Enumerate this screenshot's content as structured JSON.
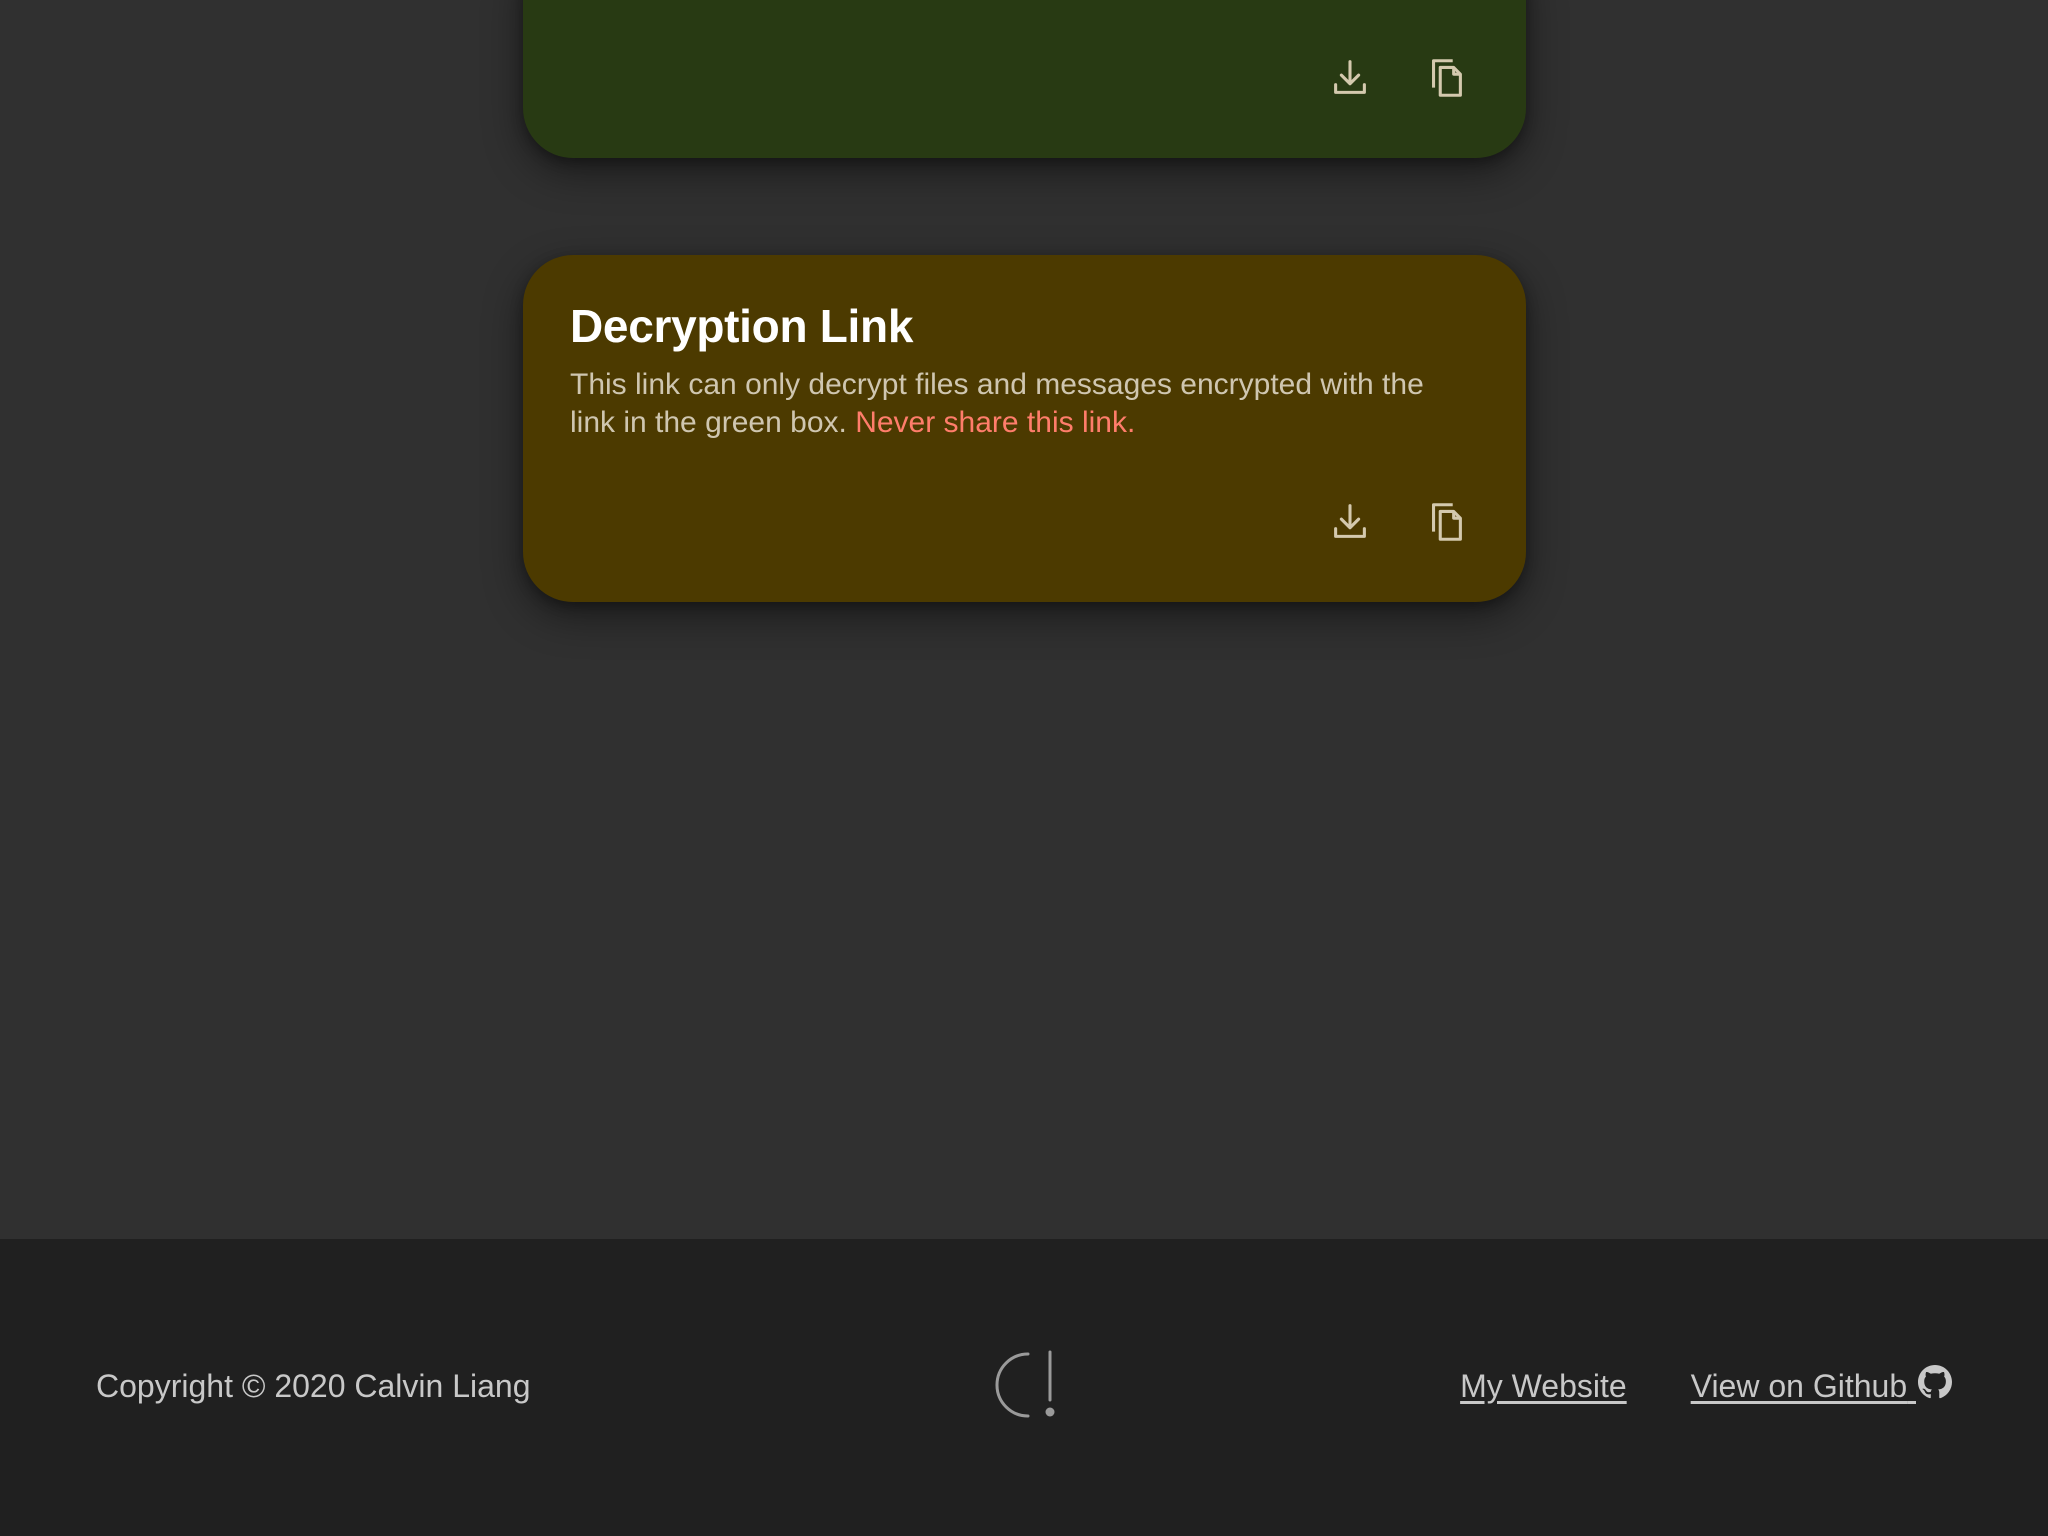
{
  "colors": {
    "background": "#303030",
    "footer_background": "#202020",
    "encryption_card": "#283a13",
    "decryption_card": "#4c3a00",
    "warning_text": "#ff7d6b",
    "icon_color": "#d4c9ae"
  },
  "encryption_card": {
    "actions": [
      {
        "name": "download",
        "icon": "download-icon"
      },
      {
        "name": "copy",
        "icon": "copy-icon"
      }
    ]
  },
  "decryption_card": {
    "title": "Decryption Link",
    "description": "This link can only decrypt files and messages encrypted with the link in the green box.",
    "warning": "Never share this link.",
    "actions": [
      {
        "name": "download",
        "icon": "download-icon"
      },
      {
        "name": "copy",
        "icon": "copy-icon"
      }
    ]
  },
  "footer": {
    "copyright": "Copyright © 2020 Calvin Liang",
    "logo": "logo-icon",
    "links": [
      {
        "label": "My Website"
      },
      {
        "label": "View on Github",
        "icon": "github-icon"
      }
    ]
  }
}
